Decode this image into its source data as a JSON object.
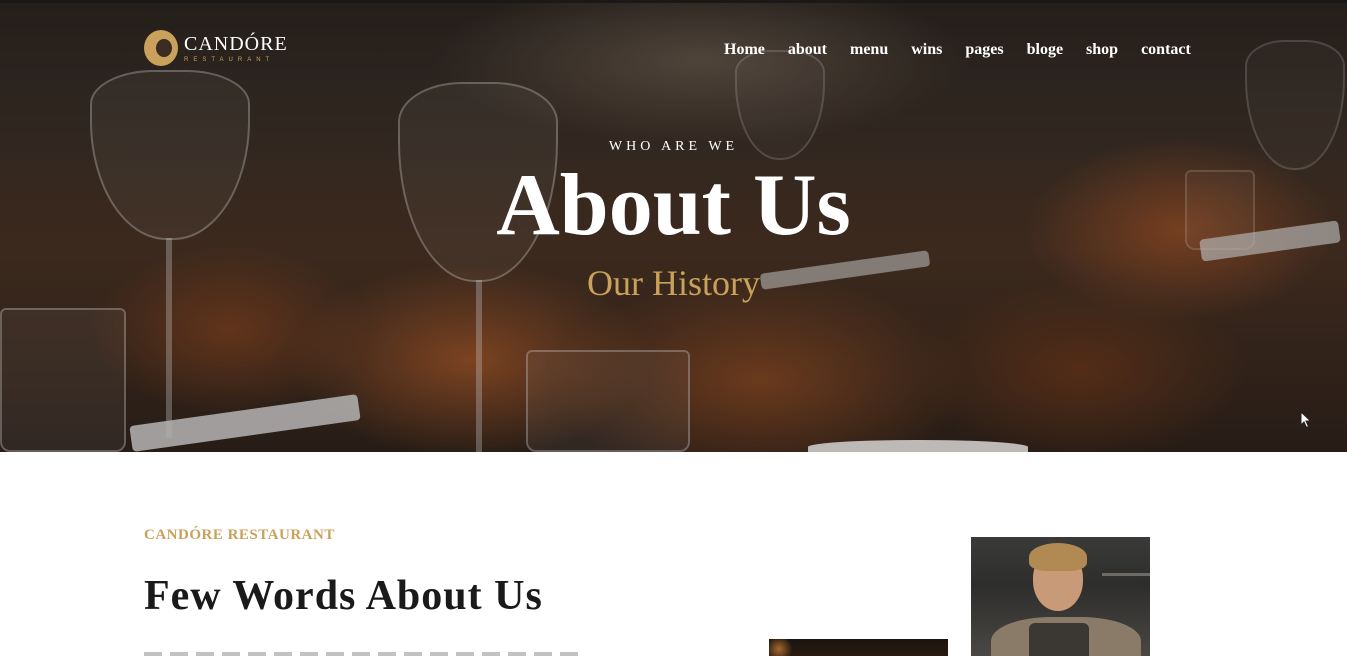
{
  "brand": {
    "name": "CANDÓRE",
    "sub": "RESTAURANT",
    "accent": "#c9a15a"
  },
  "nav": {
    "items": [
      "Home",
      "about",
      "menu",
      "wins",
      "pages",
      "bloge",
      "shop",
      "contact"
    ]
  },
  "hero": {
    "eyebrow": "WHO ARE WE",
    "title": "About Us",
    "subtitle": "Our History"
  },
  "about": {
    "kicker": "CANDÓRE RESTAURANT",
    "title": "Few Words About Us"
  },
  "icons": {
    "logo": "logo-mark-icon",
    "cursor": "mouse-pointer-icon"
  }
}
